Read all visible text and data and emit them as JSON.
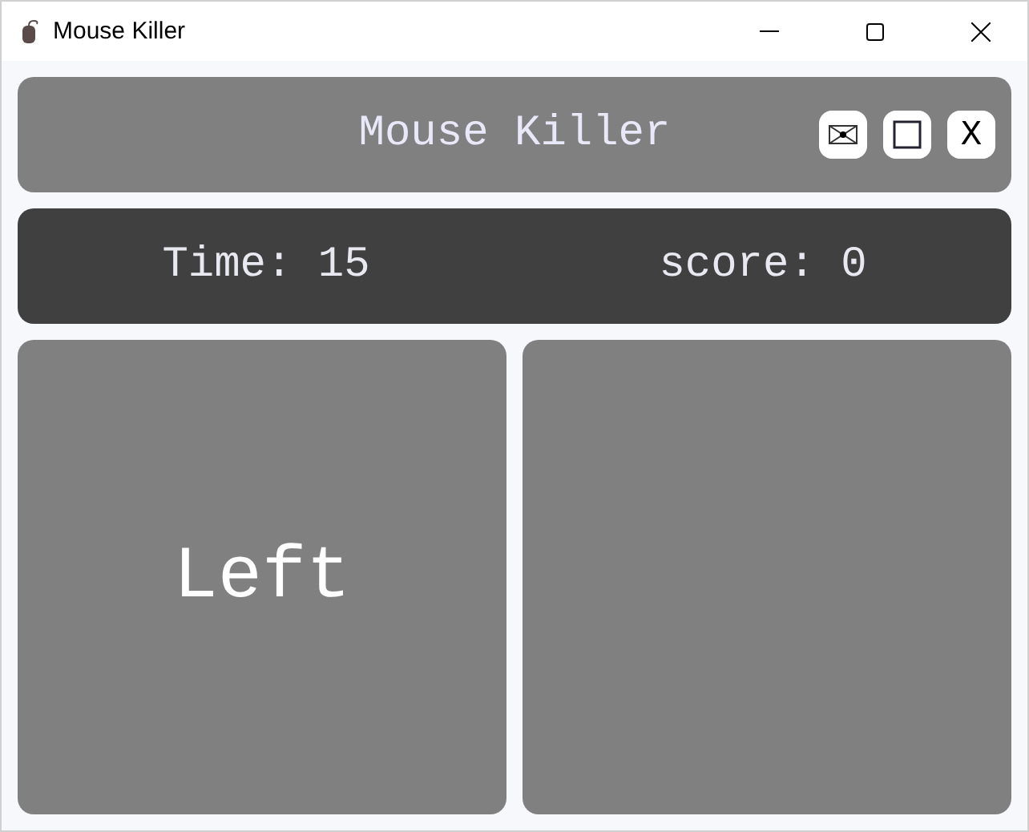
{
  "window": {
    "title": "Mouse Killer"
  },
  "header": {
    "title": "Mouse Killer",
    "buttons": [
      {
        "kind": "mail"
      },
      {
        "kind": "square"
      },
      {
        "kind": "text",
        "label": "X"
      }
    ]
  },
  "stats": {
    "time": "Time: 15",
    "score": "score: 0"
  },
  "panels": [
    {
      "kind": "labeled",
      "label": "Left"
    },
    {
      "kind": "blank"
    }
  ]
}
